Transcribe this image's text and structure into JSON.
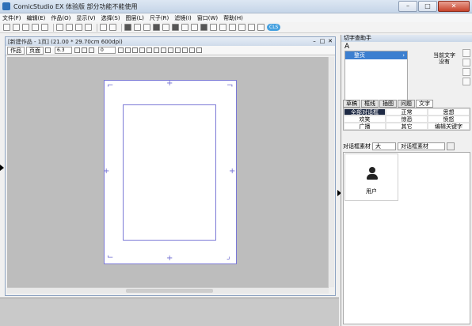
{
  "window": {
    "title": "ComicStudio EX 体验版 部分功能不能使用"
  },
  "menu": [
    "文件(F)",
    "编辑(E)",
    "作品(O)",
    "显示(V)",
    "选择(S)",
    "图层(L)",
    "尺子(R)",
    "滤镜(I)",
    "窗口(W)",
    "帮助(H)"
  ],
  "toolbar": {
    "badge": "CLS"
  },
  "document": {
    "title": "[新建作品 - 1页] (21.00 * 29.70cm 600dpi)",
    "tabs": [
      "作品",
      "页面"
    ],
    "zoom": "6.3",
    "rotation": "0"
  },
  "right_panel": {
    "header": "切字查助手",
    "glyph": "A",
    "list_item": "整页",
    "note": "当前文字\n没有",
    "tabs": [
      "草稿",
      "框线",
      "插图",
      "问题",
      "文字"
    ],
    "grid": [
      "全部对话框",
      "正常",
      "思想",
      "欢笑",
      "惊恐",
      "愤怒",
      "广播",
      "其它",
      "编辑关键字"
    ],
    "selector_label": "对话框素材",
    "size_value": "大",
    "category_value": "对话框素材",
    "material_item": "用户"
  }
}
